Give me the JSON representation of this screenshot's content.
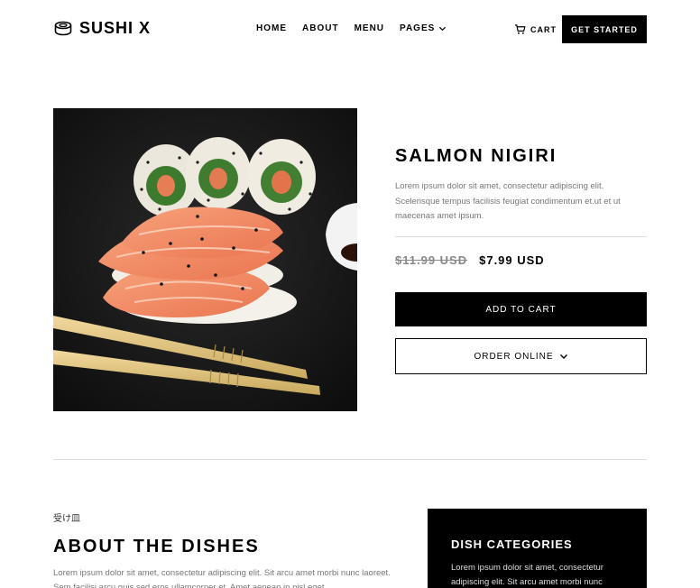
{
  "header": {
    "brand": "SUSHI X",
    "nav": [
      "HOME",
      "ABOUT",
      "MENU",
      "PAGES"
    ],
    "cart_label": "CART",
    "cta_label": "GET STARTED"
  },
  "product": {
    "title": "SALMON NIGIRI",
    "description": "Lorem ipsum dolor sit amet, consectetur adipiscing elit. Scelerisque tempus facilisis feugiat condimentum et.ut et ut maecenas amet ipsum.",
    "old_price": "$11.99 USD",
    "price": "$7.99 USD",
    "add_to_cart": "ADD TO CART",
    "order_online": "ORDER ONLINE"
  },
  "about": {
    "kanji": "受け皿",
    "title": "ABOUT THE DISHES",
    "text": "Lorem ipsum dolor sit amet, consectetur adipiscing elit. Sit arcu amet morbi nunc laoreet. Sem facilisi arcu quis sed eros ullamcorper et. Amet aenean in nisl eget"
  },
  "categories": {
    "title": "DISH CATEGORIES",
    "text": "Lorem ipsum dolor sit amet, consectetur adipiscing elit. Sit arcu amet morbi nunc"
  }
}
